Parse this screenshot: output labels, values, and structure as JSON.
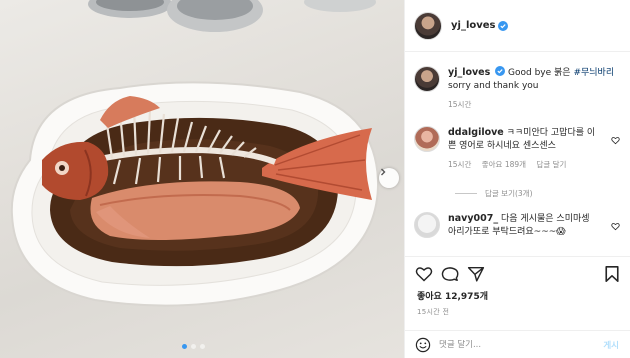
{
  "post": {
    "username": "yj_loves",
    "verified": true,
    "caption": {
      "username": "yj_loves",
      "text": "Good bye 붉은 ",
      "hashtag": "#무늬바리",
      "line2": "sorry and thank you",
      "time": "15시간"
    },
    "comments": [
      {
        "username": "ddalgilove",
        "text": "ㅋㅋ미안다 고맙다를 이쁜 영어로 하시네요 센스센스",
        "time": "15시간",
        "likes": "좋아요 189개",
        "reply": "답글 달기",
        "view_replies": "답글 보기(3개)"
      },
      {
        "username": "navy007_",
        "text": "다음 게시물은 스미마셍 아리가또로 부탁드려요~~~😱"
      }
    ],
    "likes_count": "좋아요 12,975개",
    "posted_time": "15시간 전"
  },
  "composer": {
    "placeholder": "댓글 달기...",
    "post_label": "게시"
  },
  "carousel": {
    "current": 1,
    "total": 3
  },
  "colors": {
    "accent": "#3897f0",
    "hashtag": "#003569",
    "muted": "#8e8e8e"
  }
}
